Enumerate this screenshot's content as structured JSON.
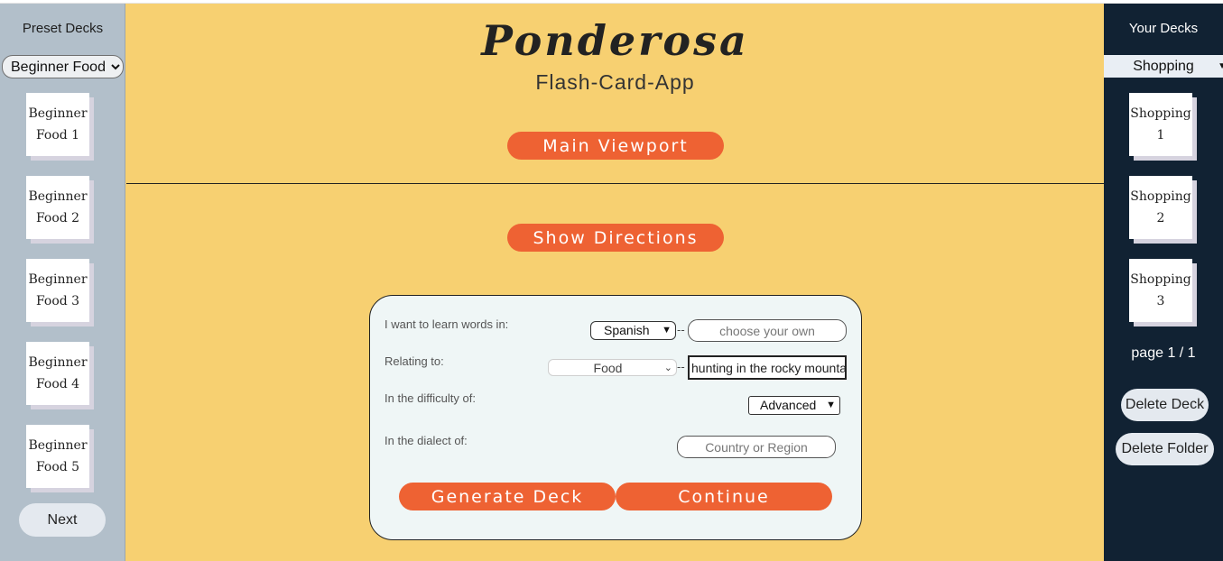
{
  "left_sidebar": {
    "title": "Preset Decks",
    "selected_deck": "Beginner Food",
    "cards": [
      {
        "line1": "Beginner",
        "line2": "Food 1"
      },
      {
        "line1": "Beginner",
        "line2": "Food 2"
      },
      {
        "line1": "Beginner",
        "line2": "Food 3"
      },
      {
        "line1": "Beginner",
        "line2": "Food 4"
      },
      {
        "line1": "Beginner",
        "line2": "Food 5"
      }
    ],
    "next_label": "Next"
  },
  "header": {
    "brand": "Ponderosa",
    "subtitle": "Flash-Card-App",
    "main_viewport_label": "Main Viewport"
  },
  "directions_label": "Show Directions",
  "form": {
    "learn_label": "I want to learn words in:",
    "language_value": "Spanish",
    "language_custom_placeholder": "choose your own",
    "relating_label": "Relating to:",
    "topic_value": "Food",
    "topic_custom_value": "hunting in the rocky mountains",
    "difficulty_label": "In the difficulty of:",
    "difficulty_value": "Advanced",
    "dialect_label": "In the dialect of:",
    "dialect_placeholder": "Country or Region",
    "separator": "--",
    "generate_label": "Generate Deck",
    "continue_label": "Continue"
  },
  "right_sidebar": {
    "title": "Your Decks",
    "selected_folder": "Shopping",
    "cards": [
      {
        "line1": "Shopping 1",
        "line2": ""
      },
      {
        "line1": "Shopping",
        "line2": "2"
      },
      {
        "line1": "Shopping",
        "line2": "3"
      }
    ],
    "page_info": "page 1 / 1",
    "delete_deck_label": "Delete Deck",
    "delete_folder_label": "Delete Folder"
  },
  "colors": {
    "main_bg": "#f7d071",
    "accent": "#ee6233",
    "left_bg": "#b2bfca",
    "right_bg": "#112233",
    "panel_bg": "#eff6f6"
  }
}
